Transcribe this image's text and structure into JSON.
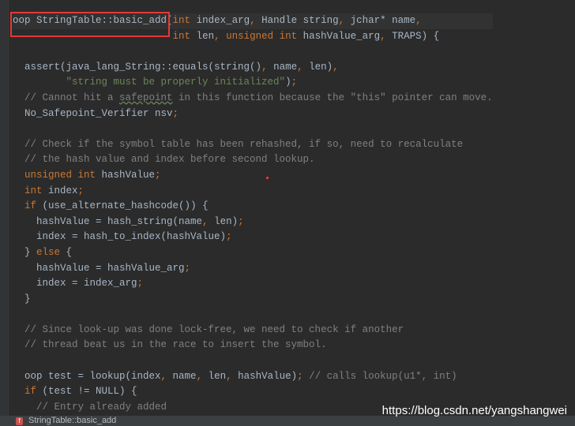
{
  "editor": {
    "lines": [
      [
        [
          "p",
          "oop StringTable::basic_add("
        ],
        [
          "k",
          "int"
        ],
        [
          "p",
          " index_arg"
        ],
        [
          "n",
          ","
        ],
        [
          "p",
          " Handle string"
        ],
        [
          "n",
          ","
        ],
        [
          "p",
          " jchar* name"
        ],
        [
          "n",
          ","
        ]
      ],
      [
        [
          "p",
          "                           "
        ],
        [
          "k",
          "int"
        ],
        [
          "p",
          " len"
        ],
        [
          "n",
          ","
        ],
        [
          "p",
          " "
        ],
        [
          "k",
          "unsigned int"
        ],
        [
          "p",
          " hashValue_arg"
        ],
        [
          "n",
          ","
        ],
        [
          "p",
          " TRAPS) {"
        ]
      ],
      [],
      [
        [
          "p",
          "  assert(java_lang_String::equals(string()"
        ],
        [
          "n",
          ","
        ],
        [
          "p",
          " name"
        ],
        [
          "n",
          ","
        ],
        [
          "p",
          " len)"
        ],
        [
          "n",
          ","
        ]
      ],
      [
        [
          "p",
          "         "
        ],
        [
          "s",
          "\"string must be properly initialized\""
        ],
        [
          "p",
          ")"
        ],
        [
          "n",
          ";"
        ]
      ],
      [
        [
          "c",
          "  // Cannot hit a "
        ],
        [
          "c u",
          "safepoint"
        ],
        [
          "c",
          " in this function because the \"this\" pointer can move."
        ]
      ],
      [
        [
          "p",
          "  No_Safepoint_Verifier nsv"
        ],
        [
          "n",
          ";"
        ]
      ],
      [],
      [
        [
          "c",
          "  // Check if the symbol table has been rehashed, if so, need to recalculate"
        ]
      ],
      [
        [
          "c",
          "  // the hash value and index before second lookup."
        ]
      ],
      [
        [
          "p",
          "  "
        ],
        [
          "k",
          "unsigned int"
        ],
        [
          "p",
          " hashValue"
        ],
        [
          "n",
          ";"
        ]
      ],
      [
        [
          "p",
          "  "
        ],
        [
          "k",
          "int"
        ],
        [
          "p",
          " index"
        ],
        [
          "n",
          ";"
        ]
      ],
      [
        [
          "p",
          "  "
        ],
        [
          "k",
          "if"
        ],
        [
          "p",
          " (use_alternate_hashcode()) {"
        ]
      ],
      [
        [
          "p",
          "    hashValue = hash_string(name"
        ],
        [
          "n",
          ","
        ],
        [
          "p",
          " len)"
        ],
        [
          "n",
          ";"
        ]
      ],
      [
        [
          "p",
          "    index = hash_to_index(hashValue)"
        ],
        [
          "n",
          ";"
        ]
      ],
      [
        [
          "p",
          "  } "
        ],
        [
          "k",
          "else"
        ],
        [
          "p",
          " {"
        ]
      ],
      [
        [
          "p",
          "    hashValue = hashValue_arg"
        ],
        [
          "n",
          ";"
        ]
      ],
      [
        [
          "p",
          "    index = index_arg"
        ],
        [
          "n",
          ";"
        ]
      ],
      [
        [
          "p",
          "  }"
        ]
      ],
      [],
      [
        [
          "c",
          "  // Since look-up was done lock-free, we need to check if another"
        ]
      ],
      [
        [
          "c",
          "  // thread beat us in the race to insert the symbol."
        ]
      ],
      [],
      [
        [
          "p",
          "  oop test = lookup(index"
        ],
        [
          "n",
          ","
        ],
        [
          "p",
          " name"
        ],
        [
          "n",
          ","
        ],
        [
          "p",
          " len"
        ],
        [
          "n",
          ","
        ],
        [
          "p",
          " hashValue)"
        ],
        [
          "n",
          ";"
        ],
        [
          "c",
          " // calls lookup(u1*, int)"
        ]
      ],
      [
        [
          "p",
          "  "
        ],
        [
          "k",
          "if"
        ],
        [
          "p",
          " (test != NULL) {"
        ]
      ],
      [
        [
          "c",
          "    // Entry already added"
        ]
      ]
    ]
  },
  "status_bar": {
    "icon": "function-icon",
    "icon_letter": "f",
    "breadcrumb": "StringTable::basic_add"
  },
  "watermark": "https://blog.csdn.net/yangshangwei",
  "colors": {
    "background": "#2b2b2b",
    "keyword": "#cc7832",
    "string": "#6a8759",
    "comment": "#808080",
    "text": "#a9b7c6",
    "highlight_box": "#e53935"
  }
}
